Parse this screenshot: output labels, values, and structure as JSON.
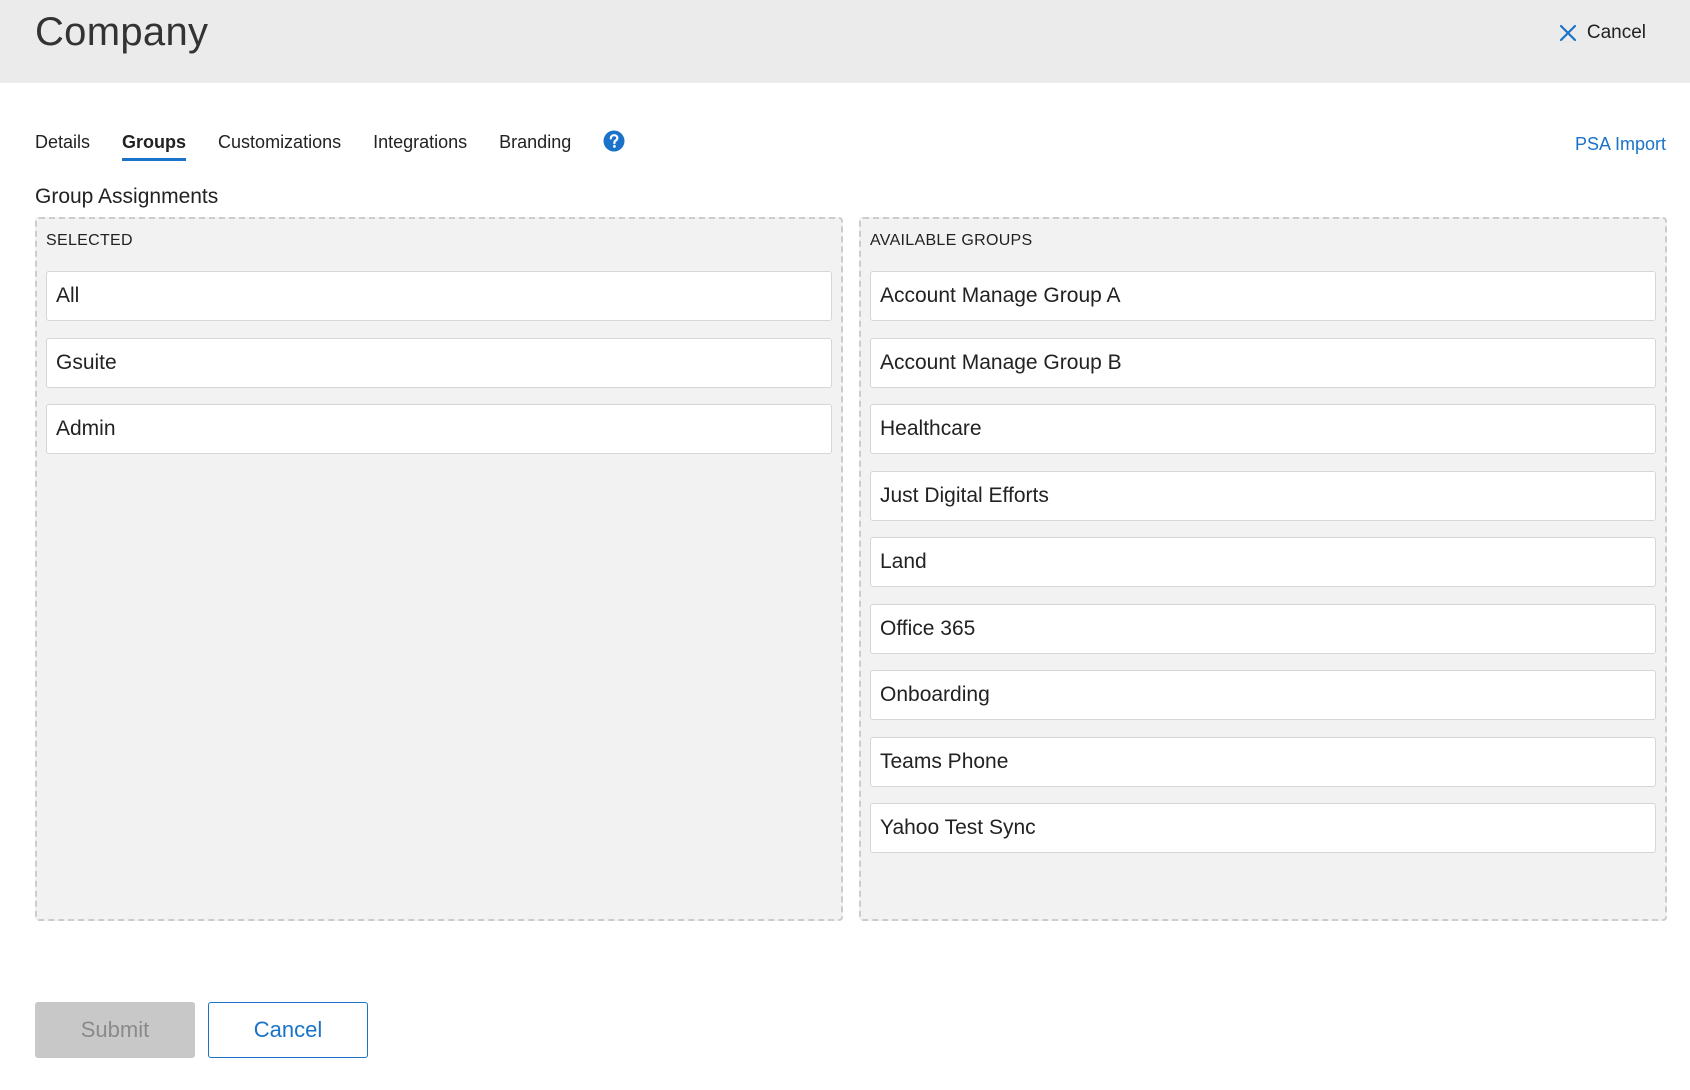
{
  "header": {
    "title": "Company",
    "cancel_label": "Cancel"
  },
  "tabs": [
    {
      "label": "Details",
      "active": false
    },
    {
      "label": "Groups",
      "active": true
    },
    {
      "label": "Customizations",
      "active": false
    },
    {
      "label": "Integrations",
      "active": false
    },
    {
      "label": "Branding",
      "active": false
    }
  ],
  "psa_import_label": "PSA Import",
  "section_title": "Group Assignments",
  "selected": {
    "label": "SELECTED",
    "items": [
      "All",
      "Gsuite",
      "Admin"
    ]
  },
  "available": {
    "label": "AVAILABLE GROUPS",
    "items": [
      "Account Manage Group A",
      "Account Manage Group B",
      "Healthcare",
      "Just Digital Efforts",
      "Land",
      "Office 365",
      "Onboarding",
      "Teams Phone",
      "Yahoo Test Sync"
    ]
  },
  "footer": {
    "submit_label": "Submit",
    "cancel_label": "Cancel"
  },
  "colors": {
    "accent": "#1a73c8",
    "header_bg": "#ebebeb",
    "panel_bg": "#f2f2f2",
    "disabled_bg": "#c8c8c8"
  },
  "icons": {
    "header_cancel": "close-icon",
    "help": "help-circle-icon"
  }
}
